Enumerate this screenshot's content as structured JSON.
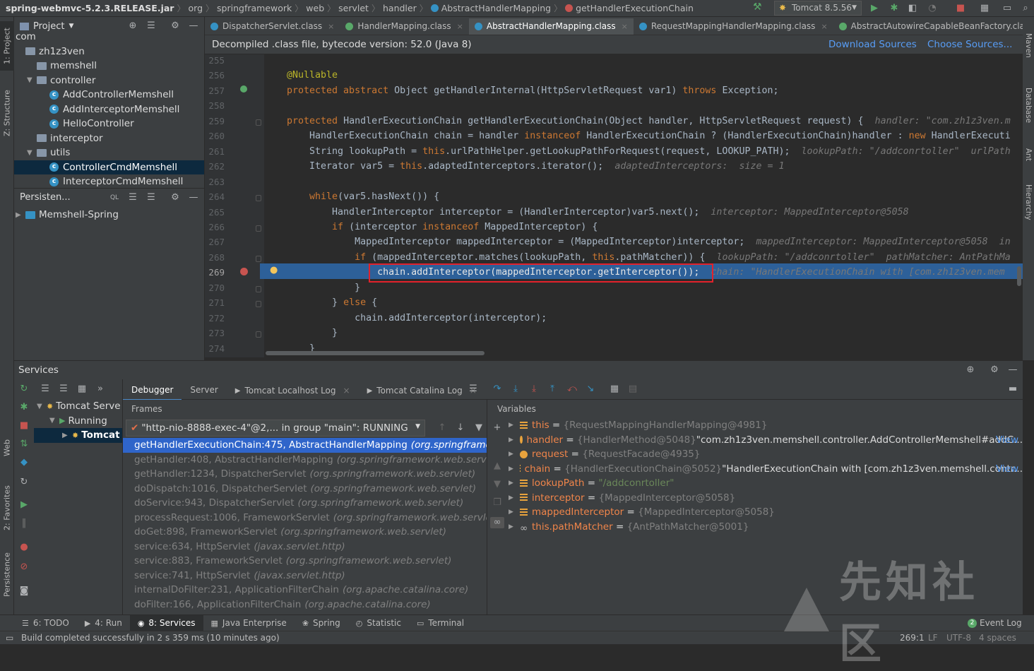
{
  "navbar": {
    "crumbs": [
      "spring-webmvc-5.2.3.RELEASE.jar",
      "org",
      "springframework",
      "web",
      "servlet",
      "handler",
      "AbstractHandlerMapping",
      "getHandlerExecutionChain"
    ],
    "run_config": "Tomcat 8.5.56"
  },
  "left_strip": {
    "project": "1: Project",
    "structure": "Z: Structure",
    "web": "Web",
    "favorites": "2: Favorites",
    "persistence": "Persistence"
  },
  "right_strip": {
    "maven": "Maven",
    "database": "Database",
    "ant": "Ant",
    "hierarchy": "Hierarchy"
  },
  "project": {
    "title": "Project",
    "tree": [
      {
        "label": "com",
        "type": "text",
        "depth": 0
      },
      {
        "label": "zh1z3ven",
        "type": "folder",
        "depth": 0
      },
      {
        "label": "memshell",
        "type": "folder",
        "depth": 1
      },
      {
        "label": "controller",
        "type": "folder",
        "depth": 1,
        "expanded": true
      },
      {
        "label": "AddControllerMemshell",
        "type": "class",
        "depth": 2
      },
      {
        "label": "AddInterceptorMemshell",
        "type": "class",
        "depth": 2
      },
      {
        "label": "HelloController",
        "type": "class",
        "depth": 2
      },
      {
        "label": "interceptor",
        "type": "folder",
        "depth": 1
      },
      {
        "label": "utils",
        "type": "folder",
        "depth": 1,
        "expanded": true
      },
      {
        "label": "ControllerCmdMemshell",
        "type": "class",
        "depth": 2,
        "selected": true
      },
      {
        "label": "InterceptorCmdMemshell",
        "type": "class",
        "depth": 2
      }
    ],
    "persistence_title": "Persisten...",
    "persistence_item": "Memshell-Spring"
  },
  "tabs": [
    {
      "label": "DispatcherServlet.class",
      "active": false
    },
    {
      "label": "HandlerMapping.class",
      "active": false
    },
    {
      "label": "AbstractHandlerMapping.class",
      "active": true
    },
    {
      "label": "RequestMappingHandlerMapping.class",
      "active": false
    },
    {
      "label": "AbstractAutowireCapableBeanFactory.class",
      "active": false
    },
    {
      "label": "Abs",
      "active": false
    }
  ],
  "banner": {
    "text": "Decompiled .class file, bytecode version: 52.0 (Java 8)",
    "download": "Download Sources",
    "choose": "Choose Sources..."
  },
  "code": {
    "line_numbers": [
      "255",
      "256",
      "257",
      "258",
      "259",
      "260",
      "261",
      "262",
      "263",
      "264",
      "265",
      "266",
      "267",
      "268",
      "269",
      "270",
      "271",
      "272",
      "273",
      "274"
    ],
    "lines": [
      [],
      [
        [
          "a",
          "@Nullable"
        ]
      ],
      [
        [
          "k",
          "protected abstract "
        ],
        [
          "",
          "Object getHandlerInternal(HttpServletRequest var1) "
        ],
        [
          "k",
          "throws "
        ],
        [
          "",
          "Exception;"
        ]
      ],
      [],
      [
        [
          "k",
          "protected "
        ],
        [
          "",
          "HandlerExecutionChain getHandlerExecutionChain(Object handler, HttpServletRequest request) {  "
        ],
        [
          "h",
          "handler: \"com.zh1z3ven.m"
        ]
      ],
      [
        [
          "",
          "    HandlerExecutionChain chain = handler "
        ],
        [
          "k",
          "instanceof "
        ],
        [
          "",
          "HandlerExecutionChain ? (HandlerExecutionChain)handler : "
        ],
        [
          "k",
          "new "
        ],
        [
          "",
          "HandlerExecuti"
        ]
      ],
      [
        [
          "",
          "    String lookupPath = "
        ],
        [
          "k",
          "this"
        ],
        [
          "",
          ".urlPathHelper.getLookupPathForRequest(request, LOOKUP_PATH);  "
        ],
        [
          "h",
          "lookupPath: \"/addconrtoller\"  urlPath"
        ]
      ],
      [
        [
          "",
          "    Iterator var5 = "
        ],
        [
          "k",
          "this"
        ],
        [
          "",
          ".adaptedInterceptors.iterator();  "
        ],
        [
          "h",
          "adaptedInterceptors:  size = 1"
        ]
      ],
      [],
      [
        [
          "",
          "    "
        ],
        [
          "k",
          "while"
        ],
        [
          "",
          "(var5.hasNext()) {"
        ]
      ],
      [
        [
          "",
          "        HandlerInterceptor interceptor = (HandlerInterceptor)var5.next();  "
        ],
        [
          "h",
          "interceptor: MappedInterceptor@5058"
        ]
      ],
      [
        [
          "",
          "        "
        ],
        [
          "k",
          "if "
        ],
        [
          "",
          "(interceptor "
        ],
        [
          "k",
          "instanceof "
        ],
        [
          "",
          "MappedInterceptor) {"
        ]
      ],
      [
        [
          "",
          "            MappedInterceptor mappedInterceptor = (MappedInterceptor)interceptor;  "
        ],
        [
          "h",
          "mappedInterceptor: MappedInterceptor@5058  in"
        ]
      ],
      [
        [
          "",
          "            "
        ],
        [
          "k",
          "if "
        ],
        [
          "",
          "(mappedInterceptor.matches(lookupPath, "
        ],
        [
          "k",
          "this"
        ],
        [
          "",
          ".pathMatcher)) {  "
        ],
        [
          "h",
          "lookupPath: \"/addconrtoller\"  pathMatcher: AntPathMa"
        ]
      ],
      [
        [
          "",
          "                chain.addInterceptor(mappedInterceptor.getInterceptor());  "
        ],
        [
          "h",
          "chain: \"HandlerExecutionChain with [com.zh1z3ven.mem"
        ]
      ],
      [
        [
          "",
          "            }"
        ]
      ],
      [
        [
          "",
          "        } "
        ],
        [
          "k",
          "else "
        ],
        [
          "",
          "{"
        ]
      ],
      [
        [
          "",
          "            chain.addInterceptor(interceptor);"
        ]
      ],
      [
        [
          "",
          "        }"
        ]
      ],
      [
        [
          "",
          "    }"
        ]
      ]
    ]
  },
  "services": {
    "title": "Services",
    "tree": [
      {
        "label": "Tomcat Serve",
        "depth": 0
      },
      {
        "label": "Running",
        "depth": 1
      },
      {
        "label": "Tomcat",
        "depth": 2,
        "selected": true
      }
    ],
    "tabs": [
      "Debugger",
      "Server",
      "Tomcat Localhost Log",
      "Tomcat Catalina Log"
    ],
    "frames_title": "Frames",
    "thread": "\"http-nio-8888-exec-4\"@2,... in group \"main\": RUNNING",
    "frames": [
      {
        "m": "getHandlerExecutionChain:475, AbstractHandlerMapping",
        "p": "(org.springframewor",
        "sel": true
      },
      {
        "m": "getHandler:408, AbstractHandlerMapping",
        "p": "(org.springframework.web.servlet.h"
      },
      {
        "m": "getHandler:1234, DispatcherServlet",
        "p": "(org.springframework.web.servlet)"
      },
      {
        "m": "doDispatch:1016, DispatcherServlet",
        "p": "(org.springframework.web.servlet)"
      },
      {
        "m": "doService:943, DispatcherServlet",
        "p": "(org.springframework.web.servlet)"
      },
      {
        "m": "processRequest:1006, FrameworkServlet",
        "p": "(org.springframework.web.servlet)"
      },
      {
        "m": "doGet:898, FrameworkServlet",
        "p": "(org.springframework.web.servlet)"
      },
      {
        "m": "service:634, HttpServlet",
        "p": "(javax.servlet.http)"
      },
      {
        "m": "service:883, FrameworkServlet",
        "p": "(org.springframework.web.servlet)"
      },
      {
        "m": "service:741, HttpServlet",
        "p": "(javax.servlet.http)"
      },
      {
        "m": "internalDoFilter:231, ApplicationFilterChain",
        "p": "(org.apache.catalina.core)"
      },
      {
        "m": "doFilter:166, ApplicationFilterChain",
        "p": "(org.apache.catalina.core)"
      }
    ],
    "variables_title": "Variables",
    "variables": [
      {
        "name": "this",
        "val": "{RequestMappingHandlerMapping@4981}",
        "str": "",
        "view": ""
      },
      {
        "name": "handler",
        "val": "{HandlerMethod@5048}",
        "str": " \"com.zh1z3ven.memshell.controller.AddControllerMemshell#addC...",
        "view": "View"
      },
      {
        "name": "request",
        "val": "{RequestFacade@4935}",
        "str": "",
        "view": ""
      },
      {
        "name": "chain",
        "val": "{HandlerExecutionChain@5052}",
        "str": " \"HandlerExecutionChain with [com.zh1z3ven.memshell.contr...",
        "view": "View"
      },
      {
        "name": "lookupPath",
        "val": "",
        "str": "\"/addconrtoller\"",
        "view": ""
      },
      {
        "name": "interceptor",
        "val": "{MappedInterceptor@5058}",
        "str": "",
        "view": ""
      },
      {
        "name": "mappedInterceptor",
        "val": "{MappedInterceptor@5058}",
        "str": "",
        "view": ""
      },
      {
        "name": "this.pathMatcher",
        "val": "{AntPathMatcher@5001}",
        "str": "",
        "view": ""
      }
    ]
  },
  "bottom_tabs": [
    "6: TODO",
    "4: Run",
    "8: Services",
    "Java Enterprise",
    "Spring",
    "Statistic",
    "Terminal"
  ],
  "event_log": {
    "count": "2",
    "label": "Event Log"
  },
  "status": {
    "message": "Build completed successfully in 2 s 359 ms (10 minutes ago)",
    "position": "269:1",
    "line_sep": "LF",
    "encoding": "UTF-8",
    "indent": "4 spaces"
  },
  "watermark": "先知社区",
  "colors": {
    "accent": "#4a88c7",
    "selection": "#2f65ca",
    "exec_line": "#2d6099",
    "highlight_box": "#e2212b",
    "keyword": "#cc7832"
  }
}
